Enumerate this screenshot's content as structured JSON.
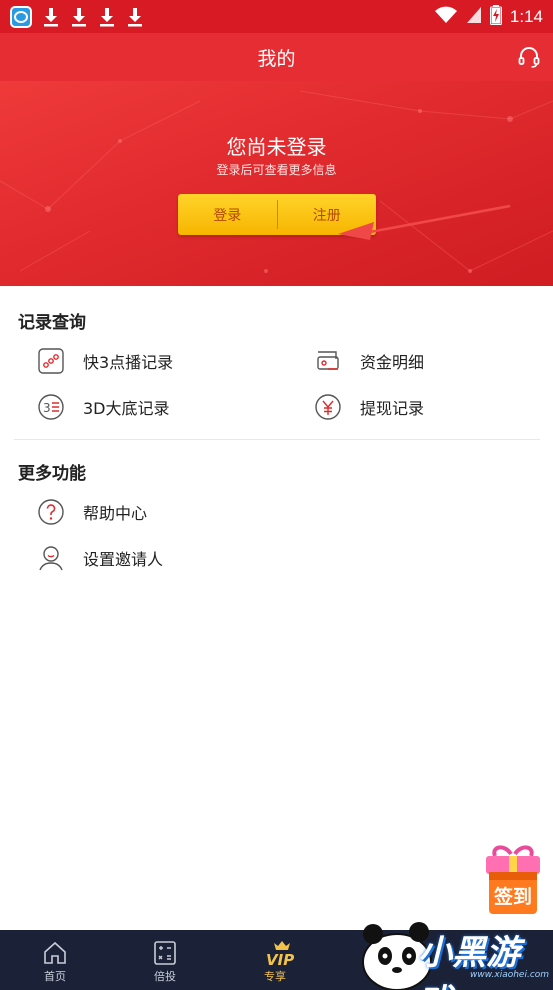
{
  "status_bar": {
    "time": "1:14",
    "icons": [
      "app-icon",
      "download-icon",
      "download-icon",
      "download-icon",
      "download-icon",
      "wifi-icon",
      "signal-icon",
      "battery-charging-icon"
    ]
  },
  "header": {
    "title": "我的",
    "right_icon": "headset-icon"
  },
  "hero": {
    "title": "您尚未登录",
    "subtitle": "登录后可查看更多信息",
    "login_label": "登录",
    "register_label": "注册"
  },
  "records": {
    "title": "记录查询",
    "items": [
      {
        "label": "快3点播记录",
        "icon": "k3-record-icon"
      },
      {
        "label": "资金明细",
        "icon": "wallet-icon"
      },
      {
        "label": "3D大底记录",
        "icon": "3d-record-icon"
      },
      {
        "label": "提现记录",
        "icon": "yuan-icon"
      }
    ]
  },
  "more": {
    "title": "更多功能",
    "items": [
      {
        "label": "帮助中心",
        "icon": "help-icon"
      },
      {
        "label": "设置邀请人",
        "icon": "person-icon"
      }
    ]
  },
  "signin": {
    "label": "签到",
    "icon": "gift-icon"
  },
  "bottom_nav": [
    {
      "label": "首页",
      "icon": "home-icon"
    },
    {
      "label": "倍投",
      "icon": "calculator-icon"
    },
    {
      "label": "专享",
      "icon": "vip-icon"
    },
    {
      "label": "",
      "icon": ""
    },
    {
      "label": "",
      "icon": ""
    }
  ],
  "watermark": {
    "text": "小黑游戏",
    "url": "www.xiaohei.com"
  },
  "colors": {
    "primary_red": "#e62d33",
    "button_yellow": "#f7b500",
    "nav_bg": "#1b2238"
  }
}
